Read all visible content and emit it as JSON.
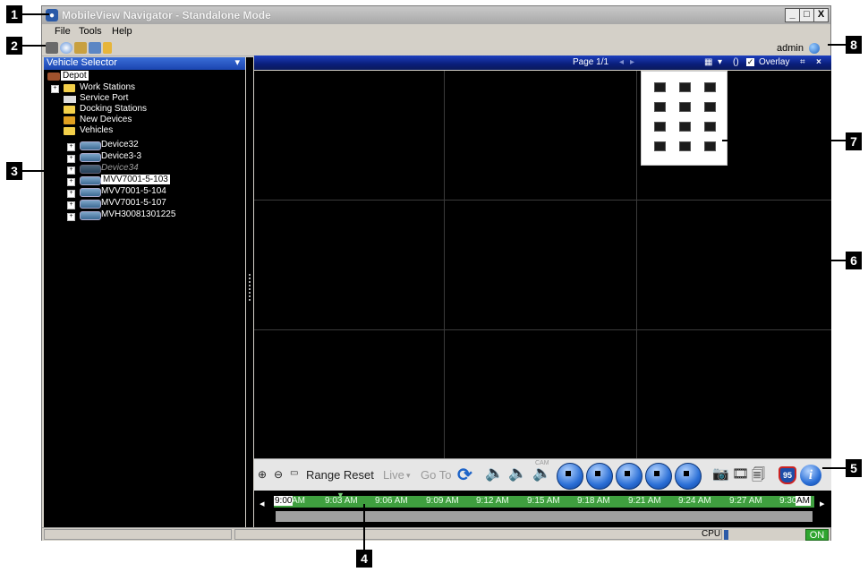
{
  "window": {
    "title": "MobileView Navigator - Standalone Mode"
  },
  "window_buttons": {
    "minimize": "_",
    "restore": "□",
    "close": "X"
  },
  "menu": {
    "items": [
      "File",
      "Tools",
      "Help"
    ]
  },
  "toolbar": {
    "user": "admin"
  },
  "left_panel": {
    "selector_label": "Vehicle Selector",
    "root": "Depot",
    "folders": [
      "Work Stations",
      "Service Port",
      "Docking Stations",
      "New Devices",
      "Vehicles"
    ],
    "vehicles": [
      "Device32",
      "Device3-3",
      "Device34",
      "MVV7001-5-103",
      "MVV7001-5-104",
      "MVV7001-5-107",
      "MVH30081301225"
    ],
    "selected_vehicle": "MVV7001-5-103"
  },
  "video": {
    "page_label": "Page 1/1",
    "overlay_label": "Overlay",
    "overlay_checked": true
  },
  "controls": {
    "range_reset": "Range Reset",
    "live": "Live",
    "goto": "Go To",
    "cam_label": "CAM",
    "route_badge": "95"
  },
  "timeline": {
    "start": "9:00",
    "ticks": [
      "AM",
      "9:03 AM",
      "9:06 AM",
      "9:09 AM",
      "9:12 AM",
      "9:15 AM",
      "9:18 AM",
      "9:21 AM",
      "9:24 AM",
      "9:27 AM",
      "9:30",
      "AM"
    ]
  },
  "status": {
    "cpu_label": "CPU",
    "on_label": "ON"
  },
  "callouts": [
    "1",
    "2",
    "3",
    "4",
    "5",
    "6",
    "7",
    "8"
  ],
  "colors": {
    "title_blue": "#1b45b0",
    "timeline_green": "#3f9f3f",
    "status_on": "#2fa52f"
  }
}
